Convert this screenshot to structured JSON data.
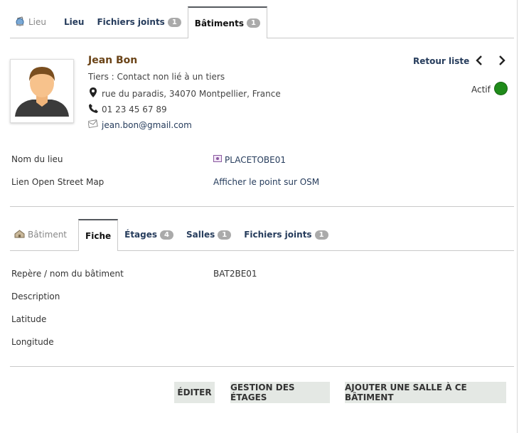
{
  "top_tabs": [
    {
      "label": "Lieu",
      "badge": null
    },
    {
      "label": "Lieu",
      "badge": null
    },
    {
      "label": "Fichiers joints",
      "badge": "1"
    },
    {
      "label": "Bâtiments",
      "badge": "1"
    }
  ],
  "contact": {
    "name": "Jean Bon",
    "tiers": "Tiers : Contact non lié à un tiers",
    "address": "rue du paradis, 34070 Montpellier, France",
    "phone": "01 23 45 67 89",
    "email": "jean.bon@gmail.com"
  },
  "nav": {
    "back": "Retour liste",
    "prev": "‹",
    "next": "›"
  },
  "status": {
    "label": "Actif",
    "color": "#1f8b1a"
  },
  "lieu_fields": [
    {
      "label": "Nom du lieu",
      "value": "PLACETOBE01"
    },
    {
      "label": "Lien Open Street Map",
      "value": "Afficher le point sur OSM"
    }
  ],
  "sub_tabs": [
    {
      "label": "Bâtiment",
      "badge": null
    },
    {
      "label": "Fiche",
      "badge": null
    },
    {
      "label": "Étages",
      "badge": "4"
    },
    {
      "label": "Salles",
      "badge": "1"
    },
    {
      "label": "Fichiers joints",
      "badge": "1"
    }
  ],
  "batiment_fields": [
    {
      "label": "Repère / nom du bâtiment",
      "value": "BAT2BE01"
    },
    {
      "label": "Description",
      "value": ""
    },
    {
      "label": "Latitude",
      "value": ""
    },
    {
      "label": "Longitude",
      "value": ""
    }
  ],
  "buttons": {
    "edit": "Éditer",
    "floors": "Gestion des étages",
    "add_room": "Ajouter une salle à ce bâtiment"
  },
  "icons": {
    "lieu": "globe-icon",
    "address": "map-marker-icon",
    "phone": "phone-icon",
    "email": "envelope-icon",
    "place": "place-icon",
    "batiment": "building-icon"
  }
}
